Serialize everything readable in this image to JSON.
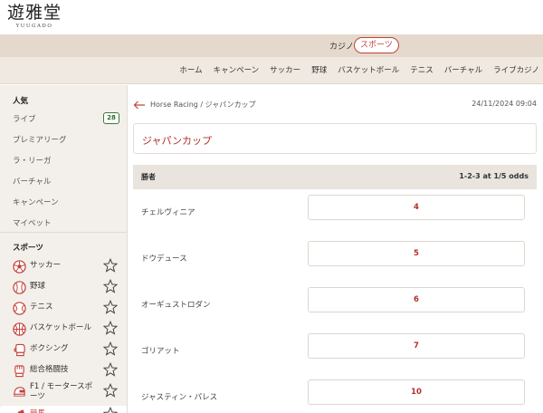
{
  "brand": {
    "kanji": "遊雅堂",
    "roman": "YUUGADO"
  },
  "switcher": {
    "casino": "カジノ",
    "sports": "スポーツ"
  },
  "nav": [
    "ホーム",
    "キャンペーン",
    "サッカー",
    "野球",
    "バスケットボール",
    "テニス",
    "バーチャル",
    "ライブカジノ"
  ],
  "sidebar": {
    "popular_heading": "人気",
    "popular_items": [
      {
        "label": "ライブ",
        "badge": "28"
      },
      {
        "label": "プレミアリーグ"
      },
      {
        "label": "ラ・リーガ"
      },
      {
        "label": "バーチャル"
      },
      {
        "label": "キャンペーン"
      },
      {
        "label": "マイベット"
      }
    ],
    "sports_heading": "スポーツ",
    "sports": [
      {
        "label": "サッカー",
        "icon": "soccer-ball-icon"
      },
      {
        "label": "野球",
        "icon": "baseball-icon"
      },
      {
        "label": "テニス",
        "icon": "tennis-ball-icon"
      },
      {
        "label": "バスケットボール",
        "icon": "basketball-icon"
      },
      {
        "label": "ボクシング",
        "icon": "boxing-glove-icon"
      },
      {
        "label": "総合格闘技",
        "icon": "mma-glove-icon"
      },
      {
        "label": "F1 / モータースポーツ",
        "icon": "racing-helmet-icon"
      },
      {
        "label": "競馬",
        "icon": "horse-racing-icon"
      }
    ]
  },
  "breadcrumb": "Horse Racing / ジャパンカップ",
  "datetime": "24/11/2024 09:04",
  "event": {
    "title": "ジャパンカップ"
  },
  "market": {
    "name": "勝者",
    "terms": "1-2-3 at 1/5 odds",
    "selections": [
      {
        "name": "チェルヴィニア",
        "odds": "4"
      },
      {
        "name": "ドウデュース",
        "odds": "5"
      },
      {
        "name": "オーギュストロダン",
        "odds": "6"
      },
      {
        "name": "ゴリアット",
        "odds": "7"
      },
      {
        "name": "ジャスティン・パレス",
        "odds": "10"
      }
    ]
  },
  "colors": {
    "accent": "#b2312a",
    "header_band": "#e4d9cc",
    "nav_band": "#efe9e2",
    "sidebar_bg": "#f3efea",
    "badge_green": "#2e6b2e"
  }
}
